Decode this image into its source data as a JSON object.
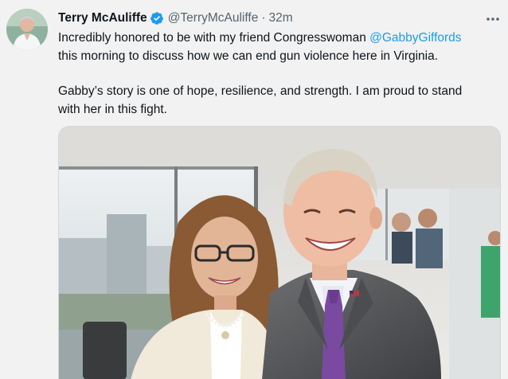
{
  "tweet": {
    "author_name": "Terry McAuliffe",
    "author_handle": "@TerryMcAuliffe",
    "separator": "·",
    "timestamp": "32m",
    "text_part1": "Incredibly honored to be with my friend Congresswoman ",
    "mention": "@GabbyGiffords",
    "text_part2": "this morning to discuss how we can end gun violence here in Virginia.",
    "text_paragraph2_line1": "Gabby’s story is one of hope, resilience, and strength. I am proud to stand",
    "text_paragraph2_line2": "with her in this fight."
  },
  "icons": {
    "verified": "verified-badge-icon",
    "more": "more-dots-icon"
  },
  "colors": {
    "link": "#1d9bf0",
    "verified": "#1d9bf0",
    "secondary_text": "#536471",
    "background": "#f2f2f2"
  }
}
